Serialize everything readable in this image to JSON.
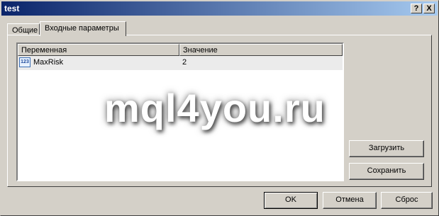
{
  "window": {
    "title": "test",
    "help_btn": "?",
    "close_btn": "X"
  },
  "tabs": [
    {
      "label": "Общие"
    },
    {
      "label": "Входные параметры"
    }
  ],
  "table": {
    "columns": [
      "Переменная",
      "Значение"
    ],
    "rows": [
      {
        "icon": "integer-variable-icon",
        "icon_text": "123",
        "name": "MaxRisk",
        "value": "2"
      }
    ]
  },
  "watermark": "mql4you.ru",
  "side_buttons": {
    "load": "Загрузить",
    "save": "Сохранить"
  },
  "bottom_buttons": {
    "ok": "OK",
    "cancel": "Отмена",
    "reset": "Сброс"
  }
}
